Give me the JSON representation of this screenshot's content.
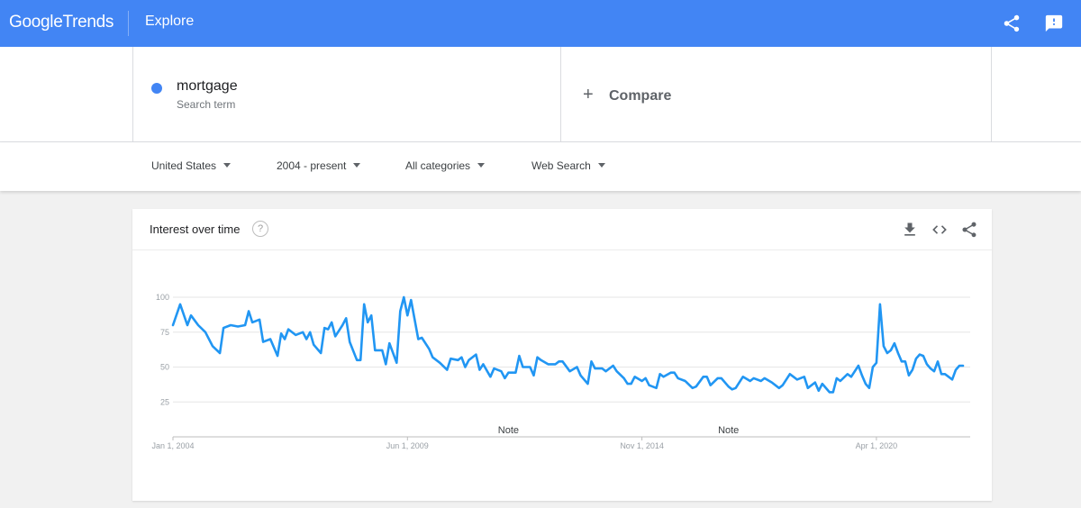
{
  "header": {
    "logo_word1": "Google",
    "logo_word2": "Trends",
    "section": "Explore",
    "bg_color": "#4285f4",
    "icons": [
      "share-icon",
      "feedback-icon"
    ]
  },
  "search_term": {
    "term": "mortgage",
    "subtitle": "Search term",
    "dot_color": "#4285f4"
  },
  "compare": {
    "plus": "+",
    "label": "Compare"
  },
  "filters": {
    "region": "United States",
    "time": "2004 - present",
    "category": "All categories",
    "property": "Web Search"
  },
  "card": {
    "title": "Interest over time",
    "help": "?",
    "icons": [
      "download-icon",
      "embed-icon",
      "share-icon"
    ]
  },
  "chart_data": {
    "type": "line",
    "title": "Interest over time",
    "xlabel": "",
    "ylabel": "",
    "ylim": [
      0,
      100
    ],
    "xlim": [
      "2004-01",
      "2022-06"
    ],
    "y_ticks": [
      "100",
      "75",
      "50",
      "25"
    ],
    "x_tick_labels": [
      "Jan 1, 2004",
      "Jun 1, 2009",
      "Nov 1, 2014",
      "Apr 1, 2020"
    ],
    "x_tick_dates": [
      "2004-01",
      "2009-06",
      "2014-11",
      "2020-04"
    ],
    "annotations": [
      {
        "label": "Note",
        "date": "2011-10"
      },
      {
        "label": "Note",
        "date": "2016-11"
      }
    ],
    "grid": true,
    "series": [
      {
        "color": "#2196f3",
        "points": [
          [
            "2004-01",
            80
          ],
          [
            "2004-03",
            95
          ],
          [
            "2004-05",
            80
          ],
          [
            "2004-06",
            87
          ],
          [
            "2004-08",
            80
          ],
          [
            "2004-10",
            75
          ],
          [
            "2004-12",
            65
          ],
          [
            "2005-02",
            60
          ],
          [
            "2005-03",
            78
          ],
          [
            "2005-05",
            80
          ],
          [
            "2005-07",
            79
          ],
          [
            "2005-09",
            80
          ],
          [
            "2005-10",
            90
          ],
          [
            "2005-11",
            82
          ],
          [
            "2006-01",
            84
          ],
          [
            "2006-02",
            68
          ],
          [
            "2006-04",
            70
          ],
          [
            "2006-06",
            58
          ],
          [
            "2006-07",
            74
          ],
          [
            "2006-08",
            70
          ],
          [
            "2006-09",
            77
          ],
          [
            "2006-11",
            73
          ],
          [
            "2007-01",
            75
          ],
          [
            "2007-02",
            70
          ],
          [
            "2007-03",
            75
          ],
          [
            "2007-04",
            66
          ],
          [
            "2007-06",
            60
          ],
          [
            "2007-07",
            78
          ],
          [
            "2007-08",
            77
          ],
          [
            "2007-09",
            82
          ],
          [
            "2007-10",
            72
          ],
          [
            "2007-12",
            80
          ],
          [
            "2008-01",
            85
          ],
          [
            "2008-02",
            68
          ],
          [
            "2008-04",
            55
          ],
          [
            "2008-05",
            55
          ],
          [
            "2008-06",
            95
          ],
          [
            "2008-07",
            82
          ],
          [
            "2008-08",
            87
          ],
          [
            "2008-09",
            62
          ],
          [
            "2008-11",
            62
          ],
          [
            "2008-12",
            52
          ],
          [
            "2009-01",
            67
          ],
          [
            "2009-03",
            53
          ],
          [
            "2009-04",
            90
          ],
          [
            "2009-05",
            100
          ],
          [
            "2009-06",
            87
          ],
          [
            "2009-07",
            98
          ],
          [
            "2009-09",
            70
          ],
          [
            "2009-10",
            71
          ],
          [
            "2009-12",
            63
          ],
          [
            "2010-01",
            57
          ],
          [
            "2010-03",
            53
          ],
          [
            "2010-05",
            48
          ],
          [
            "2010-06",
            56
          ],
          [
            "2010-08",
            55
          ],
          [
            "2010-09",
            57
          ],
          [
            "2010-10",
            50
          ],
          [
            "2010-11",
            55
          ],
          [
            "2011-01",
            59
          ],
          [
            "2011-02",
            48
          ],
          [
            "2011-03",
            52
          ],
          [
            "2011-05",
            43
          ],
          [
            "2011-06",
            49
          ],
          [
            "2011-08",
            47
          ],
          [
            "2011-09",
            42
          ],
          [
            "2011-10",
            46
          ],
          [
            "2011-12",
            46
          ],
          [
            "2012-01",
            58
          ],
          [
            "2012-02",
            50
          ],
          [
            "2012-04",
            50
          ],
          [
            "2012-05",
            44
          ],
          [
            "2012-06",
            57
          ],
          [
            "2012-07",
            55
          ],
          [
            "2012-09",
            52
          ],
          [
            "2012-11",
            52
          ],
          [
            "2012-12",
            54
          ],
          [
            "2013-01",
            54
          ],
          [
            "2013-03",
            47
          ],
          [
            "2013-05",
            50
          ],
          [
            "2013-06",
            44
          ],
          [
            "2013-08",
            38
          ],
          [
            "2013-09",
            54
          ],
          [
            "2013-10",
            49
          ],
          [
            "2013-12",
            49
          ],
          [
            "2014-01",
            47
          ],
          [
            "2014-03",
            51
          ],
          [
            "2014-04",
            47
          ],
          [
            "2014-06",
            42
          ],
          [
            "2014-07",
            38
          ],
          [
            "2014-08",
            38
          ],
          [
            "2014-09",
            43
          ],
          [
            "2014-11",
            40
          ],
          [
            "2014-12",
            42
          ],
          [
            "2015-01",
            37
          ],
          [
            "2015-03",
            35
          ],
          [
            "2015-04",
            45
          ],
          [
            "2015-05",
            43
          ],
          [
            "2015-07",
            46
          ],
          [
            "2015-08",
            46
          ],
          [
            "2015-09",
            42
          ],
          [
            "2015-11",
            40
          ],
          [
            "2016-01",
            35
          ],
          [
            "2016-02",
            36
          ],
          [
            "2016-04",
            43
          ],
          [
            "2016-05",
            43
          ],
          [
            "2016-06",
            37
          ],
          [
            "2016-08",
            42
          ],
          [
            "2016-09",
            42
          ],
          [
            "2016-11",
            36
          ],
          [
            "2016-12",
            34
          ],
          [
            "2017-01",
            35
          ],
          [
            "2017-03",
            43
          ],
          [
            "2017-05",
            40
          ],
          [
            "2017-06",
            42
          ],
          [
            "2017-08",
            40
          ],
          [
            "2017-09",
            42
          ],
          [
            "2017-11",
            39
          ],
          [
            "2018-01",
            35
          ],
          [
            "2018-02",
            37
          ],
          [
            "2018-04",
            45
          ],
          [
            "2018-05",
            43
          ],
          [
            "2018-06",
            41
          ],
          [
            "2018-08",
            43
          ],
          [
            "2018-09",
            35
          ],
          [
            "2018-11",
            39
          ],
          [
            "2018-12",
            33
          ],
          [
            "2019-01",
            38
          ],
          [
            "2019-03",
            32
          ],
          [
            "2019-04",
            32
          ],
          [
            "2019-05",
            42
          ],
          [
            "2019-06",
            40
          ],
          [
            "2019-08",
            45
          ],
          [
            "2019-09",
            43
          ],
          [
            "2019-11",
            51
          ],
          [
            "2019-12",
            44
          ],
          [
            "2020-01",
            38
          ],
          [
            "2020-02",
            35
          ],
          [
            "2020-03",
            50
          ],
          [
            "2020-04",
            53
          ],
          [
            "2020-05",
            95
          ],
          [
            "2020-06",
            65
          ],
          [
            "2020-07",
            60
          ],
          [
            "2020-08",
            62
          ],
          [
            "2020-09",
            67
          ],
          [
            "2020-10",
            60
          ],
          [
            "2020-11",
            54
          ],
          [
            "2020-12",
            54
          ],
          [
            "2021-01",
            44
          ],
          [
            "2021-02",
            48
          ],
          [
            "2021-03",
            56
          ],
          [
            "2021-04",
            59
          ],
          [
            "2021-05",
            58
          ],
          [
            "2021-06",
            52
          ],
          [
            "2021-07",
            49
          ],
          [
            "2021-08",
            47
          ],
          [
            "2021-09",
            54
          ],
          [
            "2021-10",
            45
          ],
          [
            "2021-11",
            45
          ],
          [
            "2021-12",
            43
          ],
          [
            "2022-01",
            41
          ],
          [
            "2022-02",
            48
          ],
          [
            "2022-03",
            51
          ],
          [
            "2022-04",
            51
          ]
        ]
      }
    ]
  }
}
